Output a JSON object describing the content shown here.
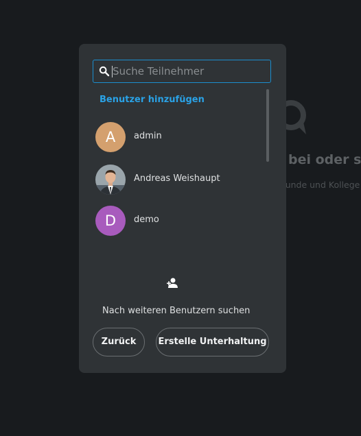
{
  "background": {
    "heading": "bei oder sta",
    "subtext": "eunde und Kollege"
  },
  "dialog": {
    "search": {
      "placeholder": "Suche Teilnehmer",
      "value": ""
    },
    "add_users_label": "Benutzer hinzufügen",
    "users": [
      {
        "name": "admin",
        "initial": "A",
        "color": "#d4a06e",
        "avatar_type": "initial"
      },
      {
        "name": "Andreas Weishaupt",
        "initial": "",
        "color": "#3d4246",
        "avatar_type": "photo"
      },
      {
        "name": "demo",
        "initial": "D",
        "color": "#a85bbd",
        "avatar_type": "initial"
      }
    ],
    "more_users_label": "Nach weiteren Benutzern suchen",
    "back_button": "Zurück",
    "create_button": "Erstelle Unterhaltung",
    "accent_color": "#2aa2e6"
  }
}
